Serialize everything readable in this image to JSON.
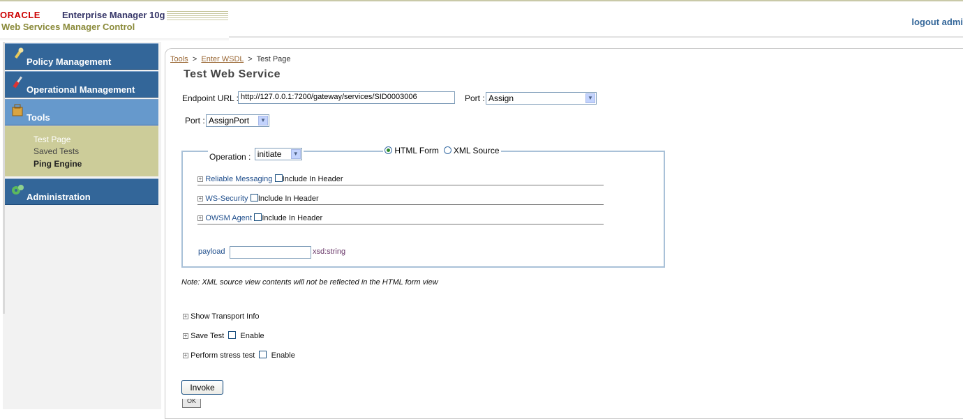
{
  "header": {
    "oracle": "ORACLE",
    "product": "Enterprise Manager 10g",
    "subtitle": "Web Services Manager Control",
    "logout": "logout admi"
  },
  "sidebar": {
    "items": [
      {
        "label": "Policy Management",
        "icon": "wrench-icon"
      },
      {
        "label": "Operational Management",
        "icon": "screwdriver-icon"
      },
      {
        "label": "Tools",
        "icon": "toolbox-icon"
      },
      {
        "label": "Administration",
        "icon": "gears-icon"
      }
    ],
    "tools_sub": [
      "Test Page",
      "Saved Tests",
      "Ping Engine"
    ]
  },
  "breadcrumb": {
    "c1": "Tools",
    "c2": "Enter WSDL",
    "c3": "Test Page",
    "sep": ">"
  },
  "main": {
    "title": "Test Web Service",
    "endpoint_label": "Endpoint URL :",
    "endpoint_value": "http://127.0.0.1:7200/gateway/services/SID0003006",
    "port1_label": "Port :",
    "port1_value": "Assign",
    "port2_label": "Port :",
    "port2_value": "AssignPort",
    "operation_label": "Operation :",
    "operation_value": "initiate",
    "mode_html": "HTML Form",
    "mode_xml": "XML Source",
    "sections": [
      {
        "name": "Reliable Messaging",
        "include": "Include In Header"
      },
      {
        "name": "WS-Security",
        "include": "Include In Header"
      },
      {
        "name": "OWSM Agent",
        "include": "Include In Header"
      }
    ],
    "payload_label": "payload",
    "payload_value": "",
    "payload_type": "xsd:string",
    "note": "Note: XML source view contents will not be reflected in the HTML form view",
    "transport": "Show Transport Info",
    "save_test": "Save Test",
    "save_enable": "Enable",
    "stress_test": "Perform stress test",
    "stress_enable": "Enable",
    "invoke": "Invoke",
    "ok": "OK"
  },
  "colors": {
    "nav_blue": "#336699",
    "nav_active": "#6699cc",
    "submenu_bg": "#cccc99",
    "oracle_red": "#cc0000"
  }
}
